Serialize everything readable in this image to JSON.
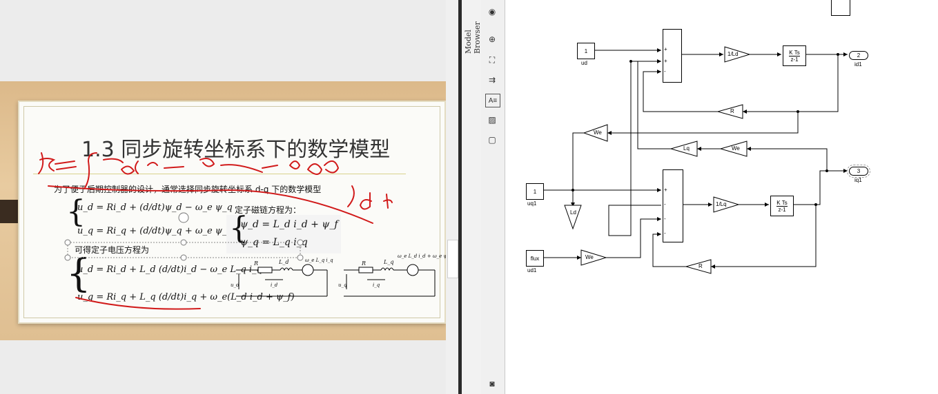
{
  "slide": {
    "title": "1.3 同步旋转坐标系下的数学模型",
    "intro": "为了便于后期控制器的设计，通常选择同步旋转坐标系 d-q 下的数学模型",
    "flux_title": "定子磁链方程为：",
    "voltage_title": "可得定子电压方程为",
    "eq_voltage1_d": "u_d = Ri_d + (d/dt)ψ_d − ω_e ψ_q",
    "eq_voltage1_q": "u_q = Ri_q + (d/dt)ψ_q + ω_e ψ_d",
    "eq_flux_d": "ψ_d = L_d i_d + ψ_f",
    "eq_flux_q": "ψ_q = L_q i_q",
    "eq_voltage2_d": "u_d = Ri_d + L_d (d/dt)i_d − ω_e L_q i_q",
    "eq_voltage2_q": "u_q = Ri_q + L_q (d/dt)i_q + ω_e(L_d i_d + ψ_f)",
    "circuit1": {
      "r": "R",
      "l": "L_d",
      "src": "ω_e L_q i_q",
      "u": "u_d",
      "i": "i_d"
    },
    "circuit2": {
      "r": "R",
      "l": "L_q",
      "src": "ω_e L_d i_d + ω_e ψ_f",
      "u": "u_q",
      "i": "i_q"
    }
  },
  "browser": {
    "label": "Model Browser"
  },
  "toolbar": {
    "items": [
      "hide-browser-icon",
      "zoom-icon",
      "fit-view-icon",
      "arrow-icon",
      "annotation-icon",
      "image-icon",
      "area-icon"
    ],
    "zoom": "⊕",
    "fit": "⛶",
    "arrow": "⇉",
    "annotation": "A≡",
    "image": "▨",
    "area": "▢",
    "camera": "◙",
    "hide": "◉"
  },
  "model": {
    "inport_ud": {
      "value": "1",
      "name": "ud"
    },
    "inport_uq1": {
      "value": "1",
      "name": "uq1"
    },
    "const_flux": {
      "value": "flux",
      "name": "ud1"
    },
    "outport_id1": {
      "value": "2",
      "name": "id1"
    },
    "outport_iq1": {
      "value": "3",
      "name": "iq1"
    },
    "gain_1_ld": "1/Ld",
    "gain_1_lq": "1/Lq",
    "gain_r_top": "R",
    "gain_r_bottom": "R",
    "gain_we_1": "We",
    "gain_we_2": "We",
    "gain_we_3": "We",
    "gain_lq": "Lq",
    "gain_ld": "Ld",
    "integrator_num": "K Ts",
    "integrator_den": "z-1",
    "sum_top_signs": [
      "+",
      "+",
      "-"
    ],
    "sum_bottom_signs": [
      "+",
      "-",
      "-",
      "-"
    ]
  }
}
